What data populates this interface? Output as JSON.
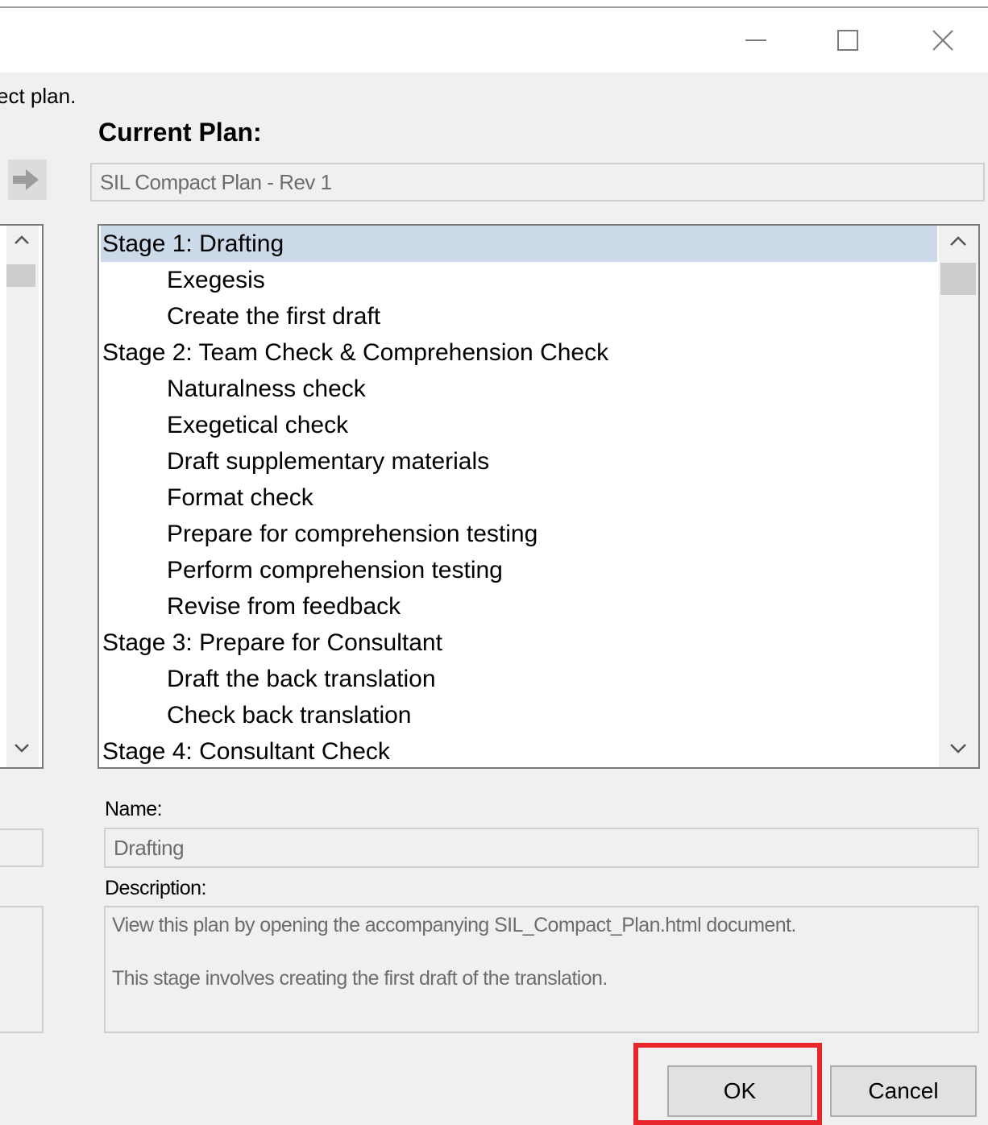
{
  "window": {
    "controls": {
      "minimize": "minimize-icon",
      "maximize": "maximize-icon",
      "close": "close-icon"
    }
  },
  "instruction_partial": "ect plan.",
  "current_plan": {
    "heading": "Current Plan:",
    "value": "SIL Compact Plan - Rev 1"
  },
  "plan_tree": {
    "items": [
      {
        "label": "Stage 1: Drafting",
        "level": 0,
        "selected": true
      },
      {
        "label": "Exegesis",
        "level": 1
      },
      {
        "label": "Create the first draft",
        "level": 1
      },
      {
        "label": "Stage 2: Team Check & Comprehension Check",
        "level": 0
      },
      {
        "label": "Naturalness check",
        "level": 1
      },
      {
        "label": "Exegetical check",
        "level": 1
      },
      {
        "label": "Draft supplementary materials",
        "level": 1
      },
      {
        "label": "Format check",
        "level": 1
      },
      {
        "label": "Prepare for comprehension testing",
        "level": 1
      },
      {
        "label": "Perform comprehension testing",
        "level": 1
      },
      {
        "label": "Revise from feedback",
        "level": 1
      },
      {
        "label": "Stage 3: Prepare for Consultant",
        "level": 0
      },
      {
        "label": "Draft the back translation",
        "level": 1
      },
      {
        "label": "Check back translation",
        "level": 1
      },
      {
        "label": "Stage 4: Consultant Check",
        "level": 0
      }
    ]
  },
  "details": {
    "name_label": "Name:",
    "name_value": "Drafting",
    "description_label": "Description:",
    "description_lines": [
      "View this plan by opening the accompanying SIL_Compact_Plan.html document.",
      "This stage involves creating the first draft of the translation."
    ]
  },
  "buttons": {
    "ok": "OK",
    "cancel": "Cancel"
  },
  "colors": {
    "highlight": "#e8262c",
    "selection": "#ccd9e8",
    "dialog_bg": "#f0f0f0"
  }
}
